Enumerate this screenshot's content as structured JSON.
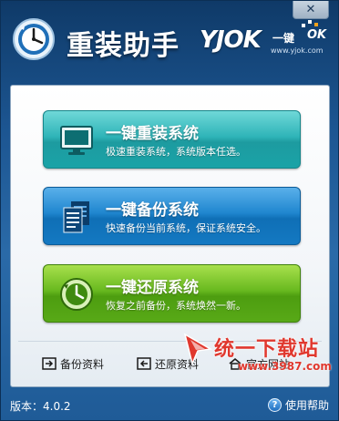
{
  "window": {
    "title": "重装助手",
    "close_glyph": "✕"
  },
  "brand": {
    "main": "YJOK",
    "accent": "一键",
    "ok": "OK",
    "url": "www.yjok.com"
  },
  "actions": [
    {
      "title": "一键重装系统",
      "subtitle": "极速重装系统，系统版本任选。",
      "color": "#2fb4b8",
      "icon": "monitor-icon"
    },
    {
      "title": "一键备份系统",
      "subtitle": "快速备份当前系统，保证系统安全。",
      "color": "#1f86cf",
      "icon": "documents-icon"
    },
    {
      "title": "一键还原系统",
      "subtitle": "恢复之前备份，系统焕然一新。",
      "color": "#68b91f",
      "icon": "clock-icon"
    }
  ],
  "links": {
    "backup_data": "备份资料",
    "restore_data": "还原资料",
    "official_site": "官方网站"
  },
  "watermark": {
    "text": "统一下载站",
    "url": "www.3987.com"
  },
  "footer": {
    "version": "版本：4.0.2",
    "help": "使用帮助",
    "help_glyph": "?"
  }
}
